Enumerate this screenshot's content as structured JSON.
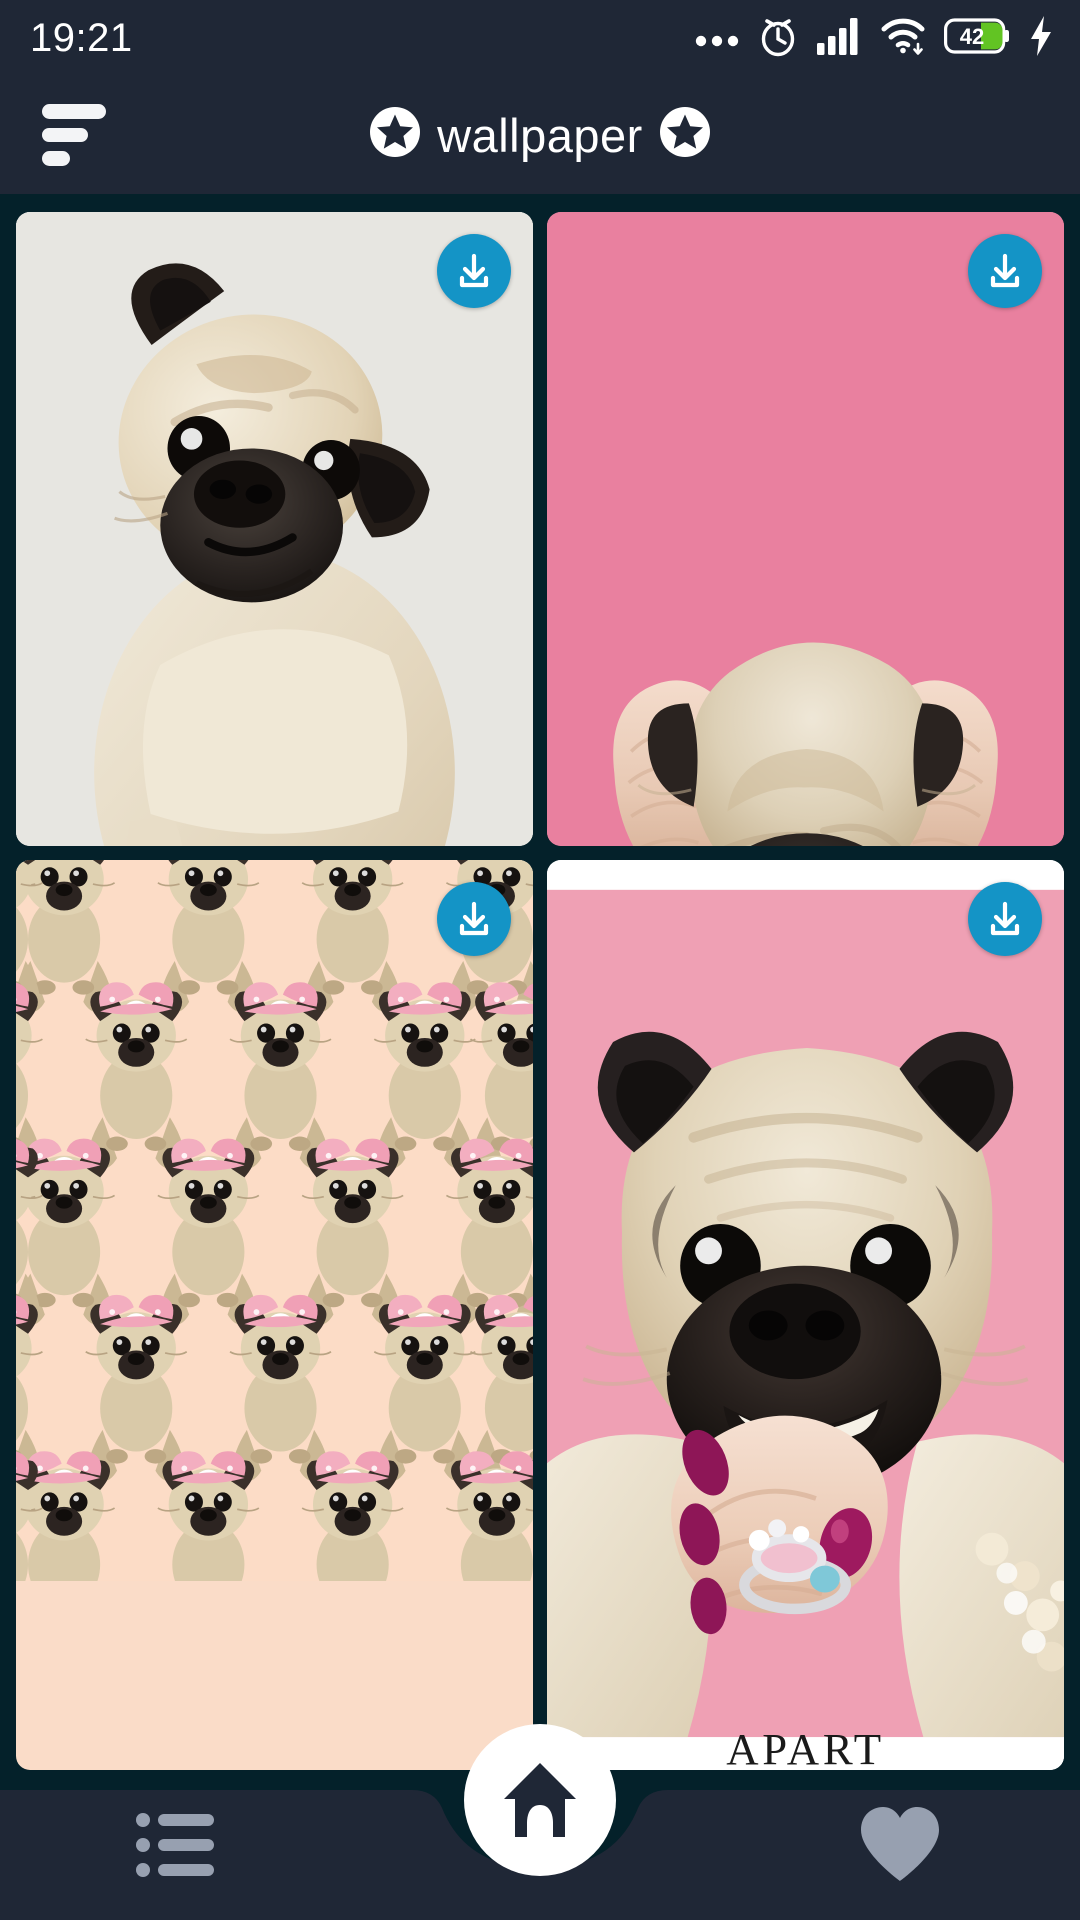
{
  "status_bar": {
    "time": "19:21",
    "battery_level": "42",
    "battery_color": "#62c423",
    "icons": [
      "more-dots-icon",
      "alarm-clock-icon",
      "signal-bars-icon",
      "wifi-icon",
      "battery-icon",
      "charging-bolt-icon"
    ]
  },
  "header": {
    "title": "wallpaper",
    "left_star": "✪",
    "right_star": "✪",
    "menu_icon": "filter-menu-icon",
    "background": "#1f2736",
    "text_color": "#ffffff"
  },
  "theme": {
    "page_background": "#04212a",
    "accent_download": "#1494c6",
    "nav_background": "#1f2736",
    "nav_icon_color": "#97a0b0",
    "fab_background": "#ffffff"
  },
  "gallery": {
    "download_label": "Download",
    "items": [
      {
        "id": "wallpaper-1",
        "name": "studio-pug-head-tilt",
        "background": "#e7e6e1",
        "download_icon": "download-icon"
      },
      {
        "id": "wallpaper-2",
        "name": "pink-squeezed-pug-face",
        "background": "#e9809f",
        "download_icon": "download-icon"
      },
      {
        "id": "wallpaper-3",
        "name": "pug-bow-pattern",
        "background": "#fadcc8",
        "download_icon": "download-icon"
      },
      {
        "id": "wallpaper-4",
        "name": "apart-jewellery-pug",
        "background": "#ffffff",
        "caption": "APART",
        "download_icon": "download-icon"
      }
    ]
  },
  "bottom_nav": {
    "items": [
      {
        "name": "categories",
        "icon": "list-icon",
        "active": false
      },
      {
        "name": "home",
        "icon": "home-icon",
        "active": true
      },
      {
        "name": "favorites",
        "icon": "heart-icon",
        "active": false
      }
    ]
  }
}
